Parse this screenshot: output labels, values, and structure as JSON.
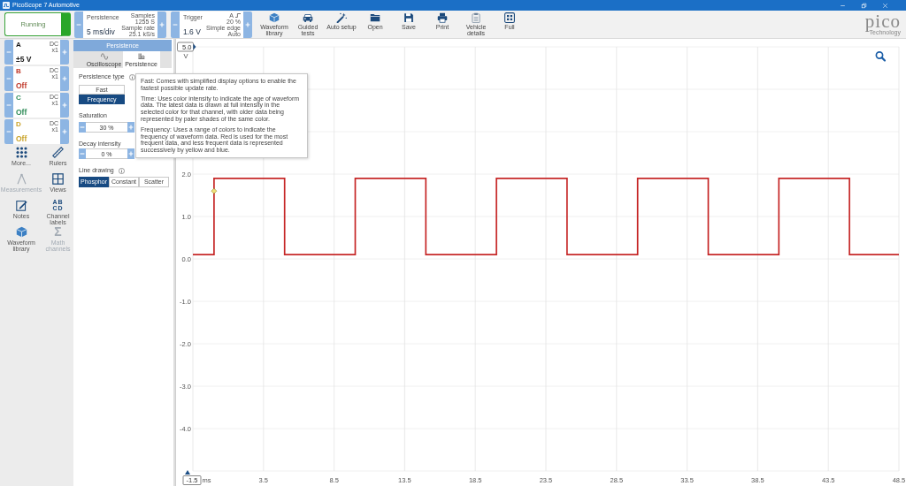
{
  "window": {
    "title": "PicoScope 7 Automotive"
  },
  "toolbar": {
    "run_button": {
      "label": "Running"
    },
    "timebase": {
      "mode": "Persistence",
      "value": "5 ms/div",
      "samples_label": "Samples",
      "samples": "1255 S",
      "sample_rate_label": "Sample rate",
      "sample_rate": "25.1 kS/s"
    },
    "trigger": {
      "label": "Trigger",
      "value": "1.6 V",
      "source": "A",
      "threshold": "20 %",
      "trigger_type": "Simple edge",
      "mode": "Auto"
    },
    "buttons": [
      {
        "label": "Waveform library"
      },
      {
        "label": "Guided tests"
      },
      {
        "label": "Auto setup"
      },
      {
        "label": "Open"
      },
      {
        "label": "Save"
      },
      {
        "label": "Print"
      },
      {
        "label": "Vehicle details"
      },
      {
        "label": "Full"
      }
    ],
    "logo": {
      "text": "pico",
      "tagline": "Technology"
    }
  },
  "channels": [
    {
      "name": "A",
      "coupling": "DC",
      "probe": "x1",
      "range": "±5 V",
      "color": "#1c1c1c"
    },
    {
      "name": "B",
      "coupling": "DC",
      "probe": "x1",
      "range": "Off",
      "color": "#c0392b"
    },
    {
      "name": "C",
      "coupling": "DC",
      "probe": "x1",
      "range": "Off",
      "color": "#2e8b57"
    },
    {
      "name": "D",
      "coupling": "DC",
      "probe": "x1",
      "range": "Off",
      "color": "#c9a227"
    }
  ],
  "tools": [
    {
      "label": "More...",
      "disabled": false
    },
    {
      "label": "Measurements",
      "disabled": true
    },
    {
      "label": "Notes",
      "disabled": false
    },
    {
      "label": "Waveform library",
      "disabled": false
    },
    {
      "label": "Rulers",
      "disabled": false
    },
    {
      "label": "Views",
      "disabled": false
    },
    {
      "label": "Channel labels",
      "disabled": false,
      "glyph": [
        "AB",
        "CD"
      ]
    },
    {
      "label": "Math channels",
      "disabled": true,
      "glyph": [
        "Σ"
      ]
    }
  ],
  "persistence_panel": {
    "title": "Persistence",
    "tabs": [
      {
        "label": "Oscilloscope",
        "selected": false
      },
      {
        "label": "Persistence",
        "selected": true
      }
    ],
    "persistence_type": {
      "label": "Persistence type",
      "options": [
        {
          "label": "Fast",
          "selected": false
        },
        {
          "label": "Frequency",
          "selected": true
        }
      ]
    },
    "saturation": {
      "label": "Saturation",
      "value": "30 %"
    },
    "decay_intensity": {
      "label": "Decay intensity",
      "value": "0 %"
    },
    "line_drawing": {
      "label": "Line drawing",
      "options": [
        {
          "label": "Phosphor",
          "selected": true
        },
        {
          "label": "Constant",
          "selected": false
        },
        {
          "label": "Scatter",
          "selected": false
        }
      ]
    }
  },
  "tooltip": {
    "paragraphs": [
      "Fast: Comes with simplified display options to enable the fastest possible update rate.",
      "Time: Uses color intensity to indicate the age of waveform data. The latest data is drawn at full intensity in the selected color for that channel, with older data being represented by paler shades of the same color.",
      "Frequency: Uses a range of colors to indicate the frequency of waveform data. Red is used for the most frequent data, and less frequent data is represented successively by yellow and blue."
    ]
  },
  "chart": {
    "chart_data": {
      "type": "line",
      "grid": true,
      "xlabel": "ms",
      "ylabel": "V",
      "xlim": [
        -1.5,
        48.5
      ],
      "ylim": [
        -5,
        5
      ],
      "xticks": [
        -1.5,
        3.5,
        8.5,
        13.5,
        18.5,
        23.5,
        28.5,
        33.5,
        38.5,
        43.5,
        48.5
      ],
      "yticks": [
        {
          "value": 5,
          "label": "5.0"
        },
        {
          "value": 2,
          "label": "2.0"
        },
        {
          "value": 1,
          "label": "1.0"
        },
        {
          "value": 0,
          "label": "0.0"
        },
        {
          "value": -1,
          "label": "-1.0"
        },
        {
          "value": -2,
          "label": "-2.0"
        },
        {
          "value": -3,
          "label": "-3.0"
        },
        {
          "value": -4,
          "label": "-4.0"
        }
      ],
      "x": [
        -1.5,
        0,
        0,
        5,
        5,
        10,
        10,
        15,
        15,
        20,
        20,
        25,
        25,
        30,
        30,
        35,
        35,
        40,
        40,
        45,
        45,
        48.5
      ],
      "series": [
        {
          "color": "#c62828",
          "values": [
            0.1,
            0.1,
            1.9,
            1.9,
            0.1,
            0.1,
            1.9,
            1.9,
            0.1,
            0.1,
            1.9,
            1.9,
            0.1,
            0.1,
            1.9,
            1.9,
            0.1,
            0.1,
            1.9,
            1.9,
            0.1,
            0.1
          ]
        }
      ]
    }
  }
}
